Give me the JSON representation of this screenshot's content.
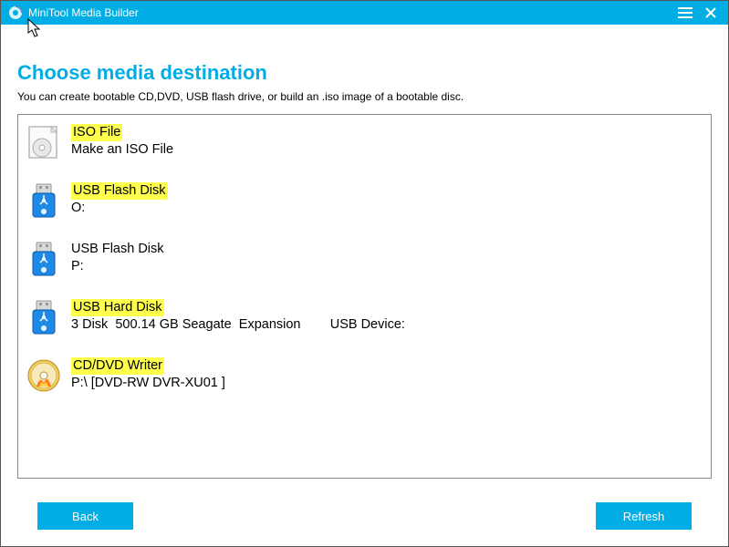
{
  "titlebar": {
    "title": "MiniTool Media Builder"
  },
  "heading": "Choose media destination",
  "subtext": "You can create bootable CD,DVD, USB flash drive, or build an .iso image of a bootable disc.",
  "items": [
    {
      "label": "ISO File",
      "sub": "Make an ISO File",
      "highlighted": true
    },
    {
      "label": "USB Flash Disk",
      "sub": "O:",
      "highlighted": true
    },
    {
      "label": "USB Flash Disk",
      "sub": "P:",
      "highlighted": false
    },
    {
      "label": "USB Hard Disk",
      "sub": "3 Disk  500.14 GB Seagate  Expansion        USB Device:",
      "highlighted": true
    },
    {
      "label": "CD/DVD Writer",
      "sub": "P:\\ [DVD-RW DVR-XU01 ]",
      "highlighted": true
    }
  ],
  "buttons": {
    "back": "Back",
    "refresh": "Refresh"
  }
}
